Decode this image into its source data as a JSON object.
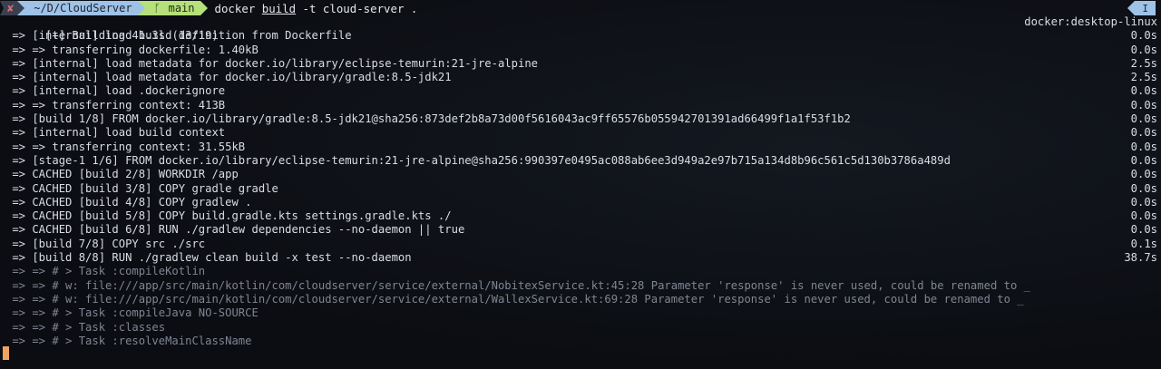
{
  "prompt": {
    "status_icon": "✘",
    "directory": "~/D/CloudServer",
    "branch_icon": "ᚴ",
    "branch": "main",
    "command_prefix": "docker",
    "command_sub": "build",
    "command_rest": " -t cloud-server ."
  },
  "mode_indicator": "I",
  "build": {
    "header": "[+] Building 41.3s (13/19)",
    "context": "docker:desktop-linux",
    "steps": [
      {
        "text": " => [internal] load build definition from Dockerfile",
        "time": "0.0s"
      },
      {
        "text": " => => transferring dockerfile: 1.40kB",
        "time": "0.0s"
      },
      {
        "text": " => [internal] load metadata for docker.io/library/eclipse-temurin:21-jre-alpine",
        "time": "2.5s"
      },
      {
        "text": " => [internal] load metadata for docker.io/library/gradle:8.5-jdk21",
        "time": "2.5s"
      },
      {
        "text": " => [internal] load .dockerignore",
        "time": "0.0s"
      },
      {
        "text": " => => transferring context: 413B",
        "time": "0.0s"
      },
      {
        "text": " => [build 1/8] FROM docker.io/library/gradle:8.5-jdk21@sha256:873def2b8a73d00f5616043ac9ff65576b055942701391ad66499f1a1f53f1b2",
        "time": "0.0s"
      },
      {
        "text": " => [internal] load build context",
        "time": "0.0s"
      },
      {
        "text": " => => transferring context: 31.55kB",
        "time": "0.0s"
      },
      {
        "text": " => [stage-1 1/6] FROM docker.io/library/eclipse-temurin:21-jre-alpine@sha256:990397e0495ac088ab6ee3d949a2e97b715a134d8b96c561c5d130b3786a489d",
        "time": "0.0s"
      },
      {
        "text": " => CACHED [build 2/8] WORKDIR /app",
        "time": "0.0s"
      },
      {
        "text": " => CACHED [build 3/8] COPY gradle gradle",
        "time": "0.0s"
      },
      {
        "text": " => CACHED [build 4/8] COPY gradlew .",
        "time": "0.0s"
      },
      {
        "text": " => CACHED [build 5/8] COPY build.gradle.kts settings.gradle.kts ./",
        "time": "0.0s"
      },
      {
        "text": " => CACHED [build 6/8] RUN ./gradlew dependencies --no-daemon || true",
        "time": "0.0s"
      },
      {
        "text": " => [build 7/8] COPY src ./src",
        "time": "0.1s"
      },
      {
        "text": " => [build 8/8] RUN ./gradlew clean build -x test --no-daemon",
        "time": "38.7s"
      }
    ],
    "logs": [
      " => => # > Task :compileKotlin",
      " => => # w: file:///app/src/main/kotlin/com/cloudserver/service/external/NobitexService.kt:45:28 Parameter 'response' is never used, could be renamed to _",
      " => => # w: file:///app/src/main/kotlin/com/cloudserver/service/external/WallexService.kt:69:28 Parameter 'response' is never used, could be renamed to _",
      " => => # > Task :compileJava NO-SOURCE",
      " => => # > Task :classes",
      " => => # > Task :resolveMainClassName"
    ]
  }
}
